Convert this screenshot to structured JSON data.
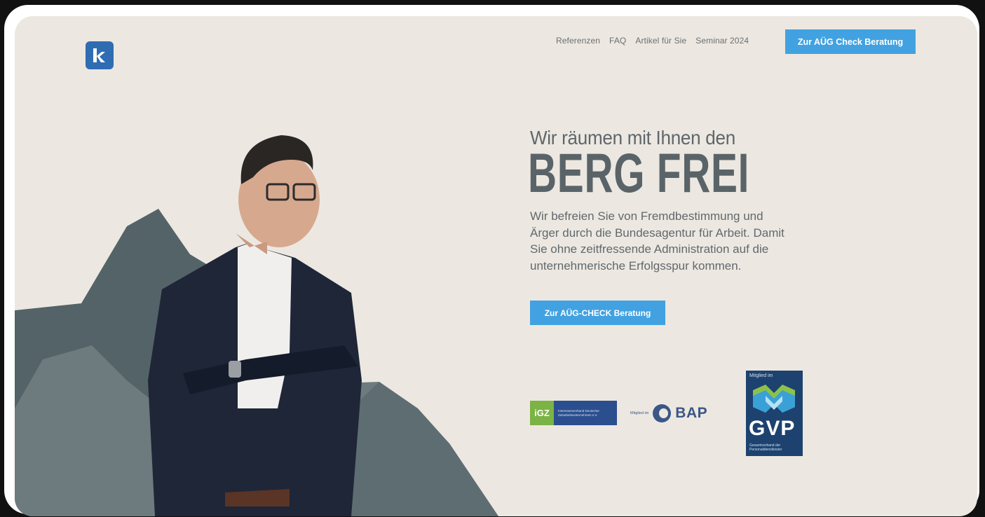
{
  "brand": {
    "logo_letter": "k",
    "color": "#2f6db3"
  },
  "nav": {
    "items": [
      "Referenzen",
      "FAQ",
      "Artikel für Sie",
      "Seminar 2024"
    ],
    "cta_label": "Zur AÜG Check Beratung"
  },
  "hero": {
    "pretitle": "Wir räumen mit Ihnen den",
    "title": "BERG FREI",
    "description": "Wir befreien Sie von Fremdbestimmung und Ärger durch die Bundesagentur für Arbeit. Damit Sie ohne zeitfressende Administration auf die unternehmerische Erfolgsspur kommen.",
    "cta_label": "Zur AÜG-CHECK Beratung"
  },
  "badges": {
    "igz": {
      "mark": "iGZ",
      "text": "Interessenverband Deutscher Zeitarbeitsunternehmen e.V."
    },
    "bap": {
      "pre": "Mitglied im",
      "text": "BAP"
    },
    "gvp": {
      "top": "Mitglied im",
      "text": "GVP",
      "small": "Gesamtverband der Personaldienstleister"
    }
  },
  "colors": {
    "background": "#ece8e1",
    "accent": "#42a2e1",
    "heading": "#5a6468",
    "mountain_dark": "#56656a",
    "mountain_light": "#6f7d80"
  }
}
